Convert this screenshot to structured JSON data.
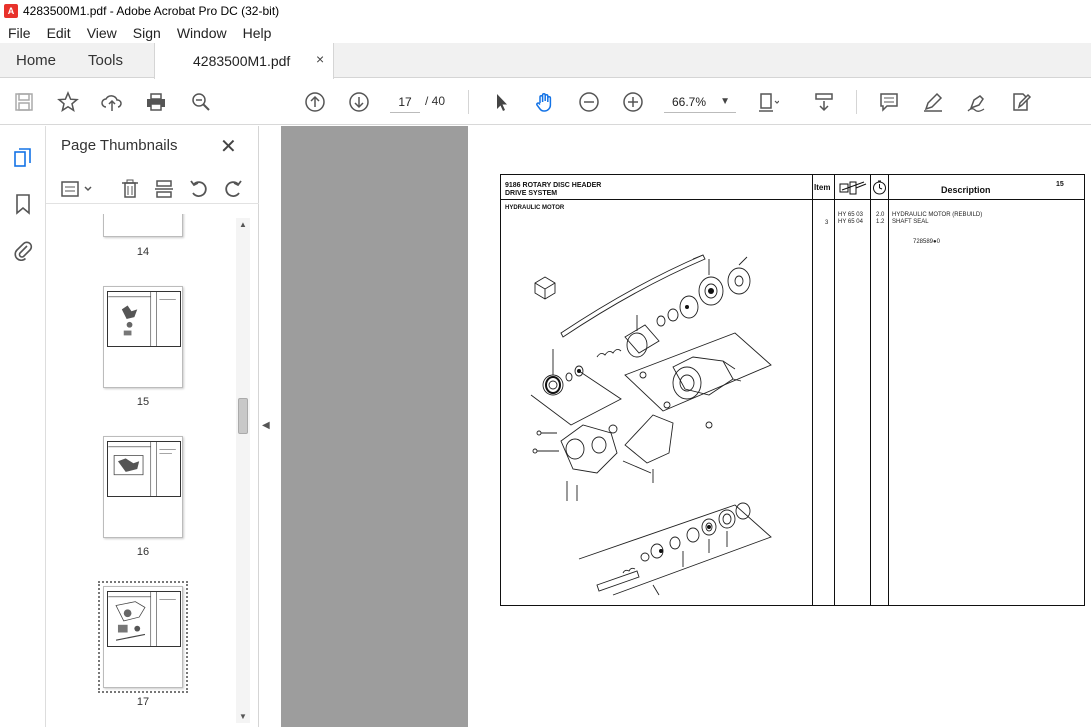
{
  "window": {
    "title": "4283500M1.pdf - Adobe Acrobat Pro DC (32-bit)"
  },
  "menu": [
    "File",
    "Edit",
    "View",
    "Sign",
    "Window",
    "Help"
  ],
  "tabs": {
    "home": "Home",
    "tools": "Tools",
    "document": "4283500M1.pdf",
    "close": "×"
  },
  "toolbar": {
    "current_page": "17",
    "total_pages": "/ 40",
    "zoom": "66.7%"
  },
  "panel": {
    "title": "Page Thumbnails",
    "close": "✕",
    "thumbnails": [
      {
        "label": "14"
      },
      {
        "label": "15"
      },
      {
        "label": "16"
      },
      {
        "label": "17",
        "selected": true
      }
    ]
  },
  "document": {
    "header_line1": "9186 ROTARY DISC HEADER",
    "header_line2": "DRIVE SYSTEM",
    "section": "HYDRAULIC MOTOR",
    "col_item": "Item",
    "col_description": "Description",
    "page_ref": "15",
    "rows": [
      {
        "item": "",
        "part": "HY 65 03",
        "qty": "2.0",
        "desc": "HYDRAULIC MOTOR (REBUILD)"
      },
      {
        "item": "3",
        "part": "HY 65 04",
        "qty": "1.2",
        "desc": "SHAFT SEAL"
      }
    ],
    "ref_number": "728589●0"
  },
  "colors": {
    "accent": "#1473e6",
    "viewer_bg": "#9d9d9d"
  }
}
